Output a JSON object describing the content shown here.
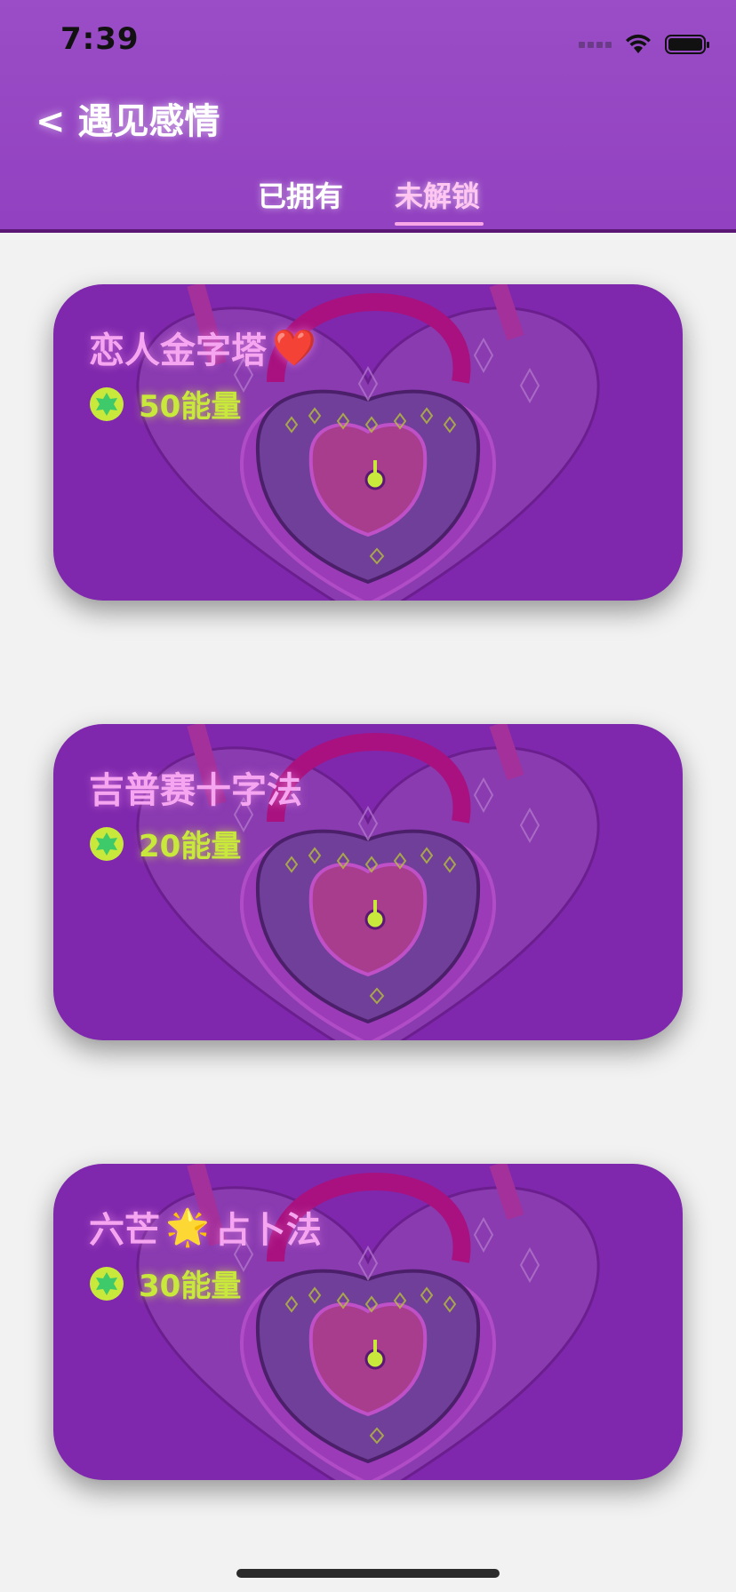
{
  "status_bar": {
    "time": "7:39"
  },
  "nav": {
    "back_label": "<  遇见感情"
  },
  "tabs": [
    {
      "label": "已拥有",
      "active": false
    },
    {
      "label": "未解锁",
      "active": true
    }
  ],
  "cards": [
    {
      "title": "恋人金字塔",
      "emoji": "❤️",
      "energy": "50能量"
    },
    {
      "title": "吉普赛十字法",
      "emoji": "",
      "energy": "20能量"
    },
    {
      "title": "六芒",
      "emoji": "🌟",
      "title_suffix": "占卜法",
      "energy": "30能量"
    }
  ],
  "colors": {
    "header": "#9a4dc6",
    "card": "#7f28ad",
    "title": "#f6a6f0",
    "energy": "#c8e83b",
    "tab_active": "#ffc6f1"
  }
}
